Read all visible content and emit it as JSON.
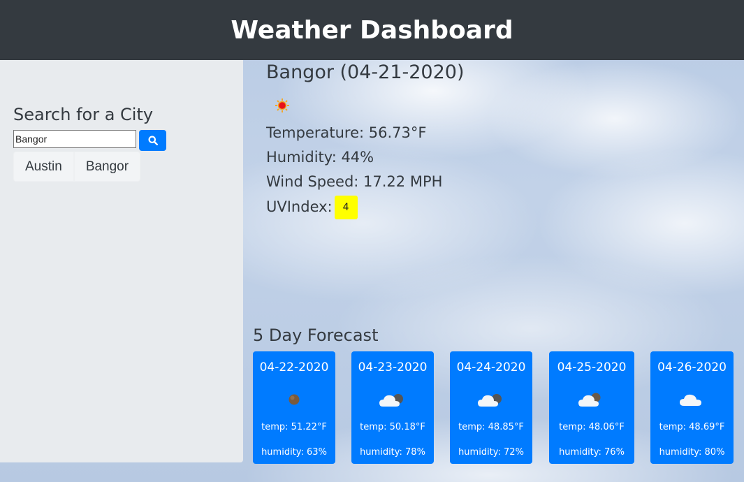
{
  "header": {
    "title": "Weather Dashboard"
  },
  "search": {
    "title": "Search for a City",
    "input_value": "Bangor",
    "button_icon": "search-icon",
    "history": [
      "Austin",
      "Bangor"
    ]
  },
  "current": {
    "title": "Bangor (04-21-2020)",
    "icon": "sun-icon",
    "temperature": "Temperature: 56.73°F",
    "humidity": "Humidity: 44%",
    "wind": "Wind Speed: 17.22 MPH",
    "uv_label": "UVIndex:",
    "uv_value": "4",
    "uv_color": "#ffff00"
  },
  "forecast": {
    "title": "5 Day Forecast",
    "card_color": "#007bff",
    "days": [
      {
        "date": "04-22-2020",
        "icon": "moon-icon",
        "temp": "temp: 51.22°F",
        "humidity": "humidity: 63%"
      },
      {
        "date": "04-23-2020",
        "icon": "cloud-moon-icon",
        "temp": "temp: 50.18°F",
        "humidity": "humidity: 78%"
      },
      {
        "date": "04-24-2020",
        "icon": "cloud-moon-icon",
        "temp": "temp: 48.85°F",
        "humidity": "humidity: 72%"
      },
      {
        "date": "04-25-2020",
        "icon": "cloud-moon-icon",
        "temp": "temp: 48.06°F",
        "humidity": "humidity: 76%"
      },
      {
        "date": "04-26-2020",
        "icon": "cloud-icon",
        "temp": "temp: 48.69°F",
        "humidity": "humidity: 80%"
      }
    ]
  }
}
